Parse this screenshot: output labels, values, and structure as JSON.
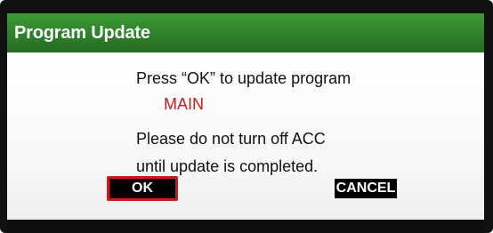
{
  "dialog": {
    "title": "Program Update",
    "message_line1": "Press “OK” to update program",
    "program_name": "MAIN",
    "message_line3": "Please do not turn off ACC",
    "message_line4": "until update is completed.",
    "ok_label": "OK",
    "cancel_label": "CANCEL"
  },
  "colors": {
    "title_bar": "#2f7f2b",
    "program_name_text": "#c51f1f",
    "ok_focus_border": "#d01818",
    "button_bg": "#000000"
  }
}
